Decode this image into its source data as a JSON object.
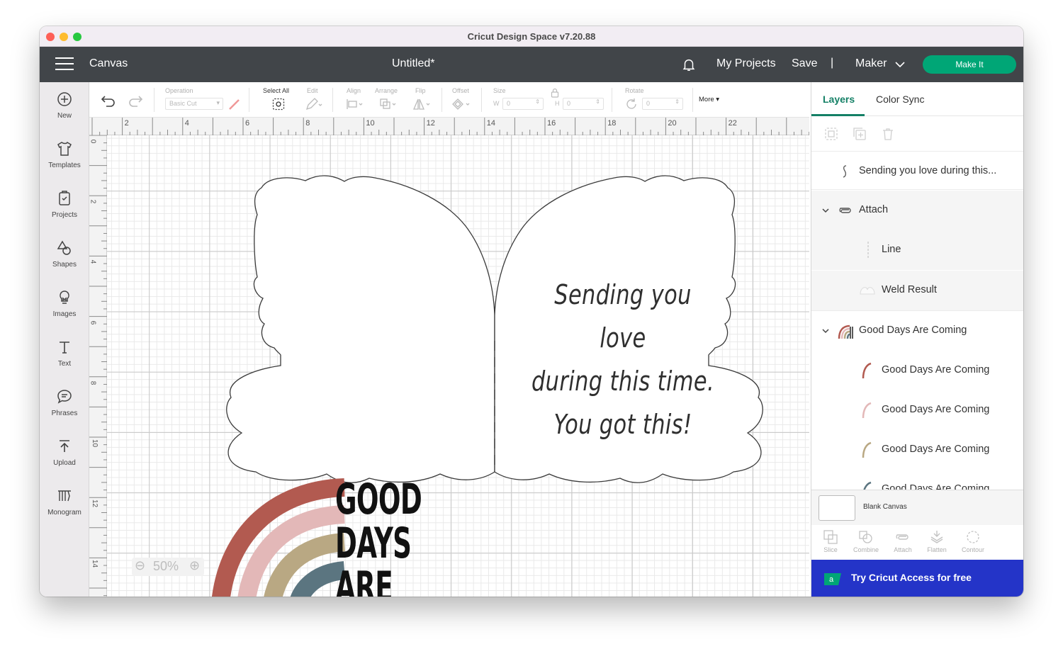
{
  "window": {
    "title": "Cricut Design Space  v7.20.88"
  },
  "topbar": {
    "screen_title": "Canvas",
    "document_title": "Untitled*",
    "my_projects": "My Projects",
    "save": "Save",
    "separator": "|",
    "machine": "Maker",
    "make_it": "Make It"
  },
  "sidebar": {
    "items": [
      {
        "label": "New",
        "icon": "plus-circle-icon"
      },
      {
        "label": "Templates",
        "icon": "shirt-icon"
      },
      {
        "label": "Projects",
        "icon": "projects-icon"
      },
      {
        "label": "Shapes",
        "icon": "shapes-icon"
      },
      {
        "label": "Images",
        "icon": "bulb-icon"
      },
      {
        "label": "Text",
        "icon": "text-icon"
      },
      {
        "label": "Phrases",
        "icon": "chat-icon"
      },
      {
        "label": "Upload",
        "icon": "upload-icon"
      },
      {
        "label": "Monogram",
        "icon": "monogram-icon"
      }
    ]
  },
  "toolbar": {
    "operation_label": "Operation",
    "operation_value": "Basic Cut",
    "select_all": "Select All",
    "edit": "Edit",
    "align": "Align",
    "arrange": "Arrange",
    "flip": "Flip",
    "offset": "Offset",
    "size": "Size",
    "w_label": "W",
    "w_value": "0",
    "h_label": "H",
    "h_value": "0",
    "rotate": "Rotate",
    "rotate_value": "0",
    "more": "More"
  },
  "ruler": {
    "horizontal": [
      "2",
      "4",
      "6",
      "8",
      "10",
      "12",
      "14",
      "16",
      "18",
      "20",
      "22"
    ],
    "vertical": [
      "0",
      "2",
      "4",
      "6",
      "8",
      "10",
      "12",
      "14"
    ]
  },
  "canvas": {
    "card_text_lines": [
      "Sending you love",
      "during this time.",
      "You got this!"
    ],
    "gd_lines": [
      "GOOD",
      "DAYS",
      "ARE"
    ],
    "zoom_minus": "⊖",
    "zoom": "50%",
    "zoom_plus": "⊕"
  },
  "layers_panel": {
    "tabs": [
      "Layers",
      "Color Sync"
    ],
    "layers": [
      {
        "name": "Sending you love during this..."
      },
      {
        "name": "Attach",
        "group": true
      },
      {
        "name": "Line"
      },
      {
        "name": "Weld Result"
      },
      {
        "name": "Good Days Are Coming",
        "group": true
      },
      {
        "name": "Good Days Are Coming",
        "color": "#b25a50"
      },
      {
        "name": "Good Days Are Coming",
        "color": "#e3b8b8"
      },
      {
        "name": "Good Days Are Coming",
        "color": "#b9a883"
      },
      {
        "name": "Good Days Are Coming",
        "color": "#5b7580"
      }
    ],
    "blank_canvas": "Blank Canvas",
    "actions": [
      "Slice",
      "Combine",
      "Attach",
      "Flatten",
      "Contour"
    ],
    "access": "Try Cricut Access for free"
  },
  "colors": {
    "accent_green": "#00a676",
    "tab_green": "#148066",
    "topbar": "#414549",
    "access_blue": "#2434c8",
    "rainbow": [
      "#b25a50",
      "#e3b8b8",
      "#b9a883",
      "#5b7580"
    ]
  }
}
